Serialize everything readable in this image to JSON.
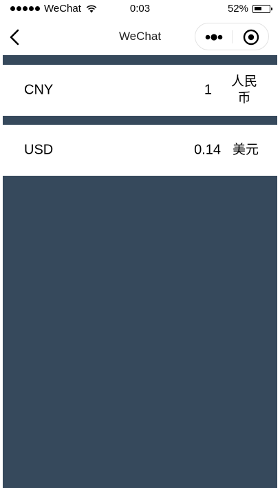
{
  "status_bar": {
    "carrier": "WeChat",
    "time": "0:03",
    "battery_percent": "52%",
    "battery_level": 0.52
  },
  "nav_bar": {
    "title": "WeChat"
  },
  "currencies": [
    {
      "code": "CNY",
      "value": "1",
      "name": "人民币"
    },
    {
      "code": "USD",
      "value": "0.14",
      "name": "美元"
    }
  ],
  "colors": {
    "content_background": "#36495c",
    "row_background": "#ffffff"
  },
  "icons": {
    "back": "chevron-left-icon",
    "more": "more-dots-icon",
    "close": "target-circle-icon",
    "wifi": "wifi-icon",
    "battery": "battery-icon",
    "signal": "signal-dots-icon"
  }
}
